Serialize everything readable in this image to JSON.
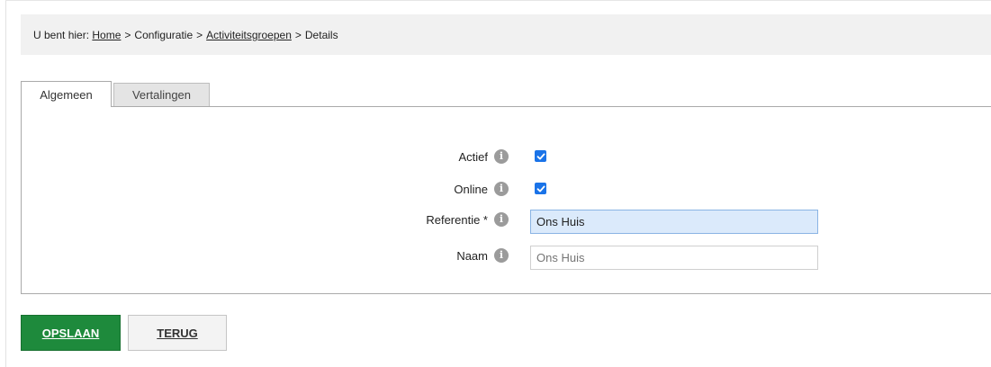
{
  "breadcrumb": {
    "prefix": "U bent hier:",
    "home": "Home",
    "sep1": ">",
    "configuratie": "Configuratie",
    "sep2": ">",
    "activiteitsgroepen": "Activiteitsgroepen",
    "sep3": ">",
    "current": "Details"
  },
  "tabs": [
    {
      "label": "Algemeen",
      "active": true
    },
    {
      "label": "Vertalingen",
      "active": false
    }
  ],
  "form": {
    "actief": {
      "label": "Actief",
      "checked": true
    },
    "online": {
      "label": "Online",
      "checked": true
    },
    "referentie": {
      "label": "Referentie *",
      "value": "Ons Huis"
    },
    "naam": {
      "label": "Naam",
      "placeholder": "Ons Huis"
    }
  },
  "info_glyph": "i",
  "buttons": {
    "save": "OPSLAAN",
    "back": "TERUG"
  },
  "colors": {
    "save_button": "#1e8a3c",
    "checkbox": "#1a73e8",
    "focused_input_bg": "#dbeafb"
  },
  "icons": {
    "info": "info-icon",
    "check": "checkmark-icon"
  }
}
